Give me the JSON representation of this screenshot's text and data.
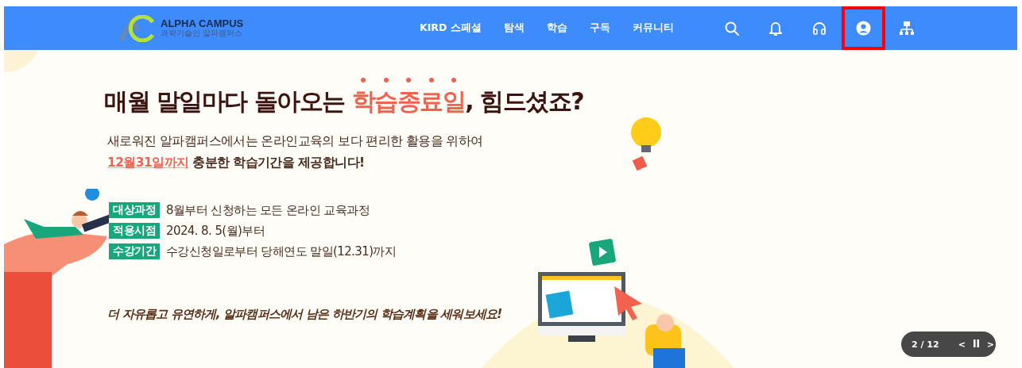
{
  "header": {
    "logo": {
      "title": "ALPHA CAMPUS",
      "subtitle": "과학기술인 알파캠퍼스"
    },
    "nav": [
      {
        "label": "KIRD 스페셜"
      },
      {
        "label": "탐색"
      },
      {
        "label": "학습"
      },
      {
        "label": "구독"
      },
      {
        "label": "커뮤니티"
      }
    ],
    "icons": [
      {
        "kind": "search",
        "highlighted": false
      },
      {
        "kind": "bell",
        "highlighted": false
      },
      {
        "kind": "headset",
        "highlighted": false
      },
      {
        "kind": "user",
        "highlighted": true
      },
      {
        "kind": "sitemap",
        "highlighted": false
      }
    ]
  },
  "banner": {
    "headline": [
      {
        "text": "매월 말일마다 돌아오는 ",
        "emphasis": false
      },
      {
        "text": "학습종료일",
        "emphasis": true
      },
      {
        "text": ", 힘드셨죠?",
        "emphasis": false
      }
    ],
    "intro": [
      [
        {
          "text": "새로워진 알파캠퍼스에서는 온라인교육의 보다 편리한 활용을 위하여",
          "emphasis": false
        }
      ],
      [
        {
          "text": "12월31일까지",
          "emphasis": true
        },
        {
          "text": " 충분한 학습기간을 제공합니다!",
          "emphasis": false
        }
      ]
    ],
    "details": [
      {
        "tag": "대상과정",
        "value": "8월부터 신청하는 모든 온라인 교육과정"
      },
      {
        "tag": "적용시점",
        "value": "2024. 8. 5(월)부터"
      },
      {
        "tag": "수강기간",
        "value": "수강신청일로부터 당해연도 말일(12.31)까지"
      }
    ],
    "closing": "더 자유롭고 유연하게, 알파캠퍼스에서 남은 하반기의 학습계획을 세워보세요!"
  },
  "slider": {
    "counter": "2 / 12",
    "prev": "<",
    "next": ">",
    "paused": false
  }
}
